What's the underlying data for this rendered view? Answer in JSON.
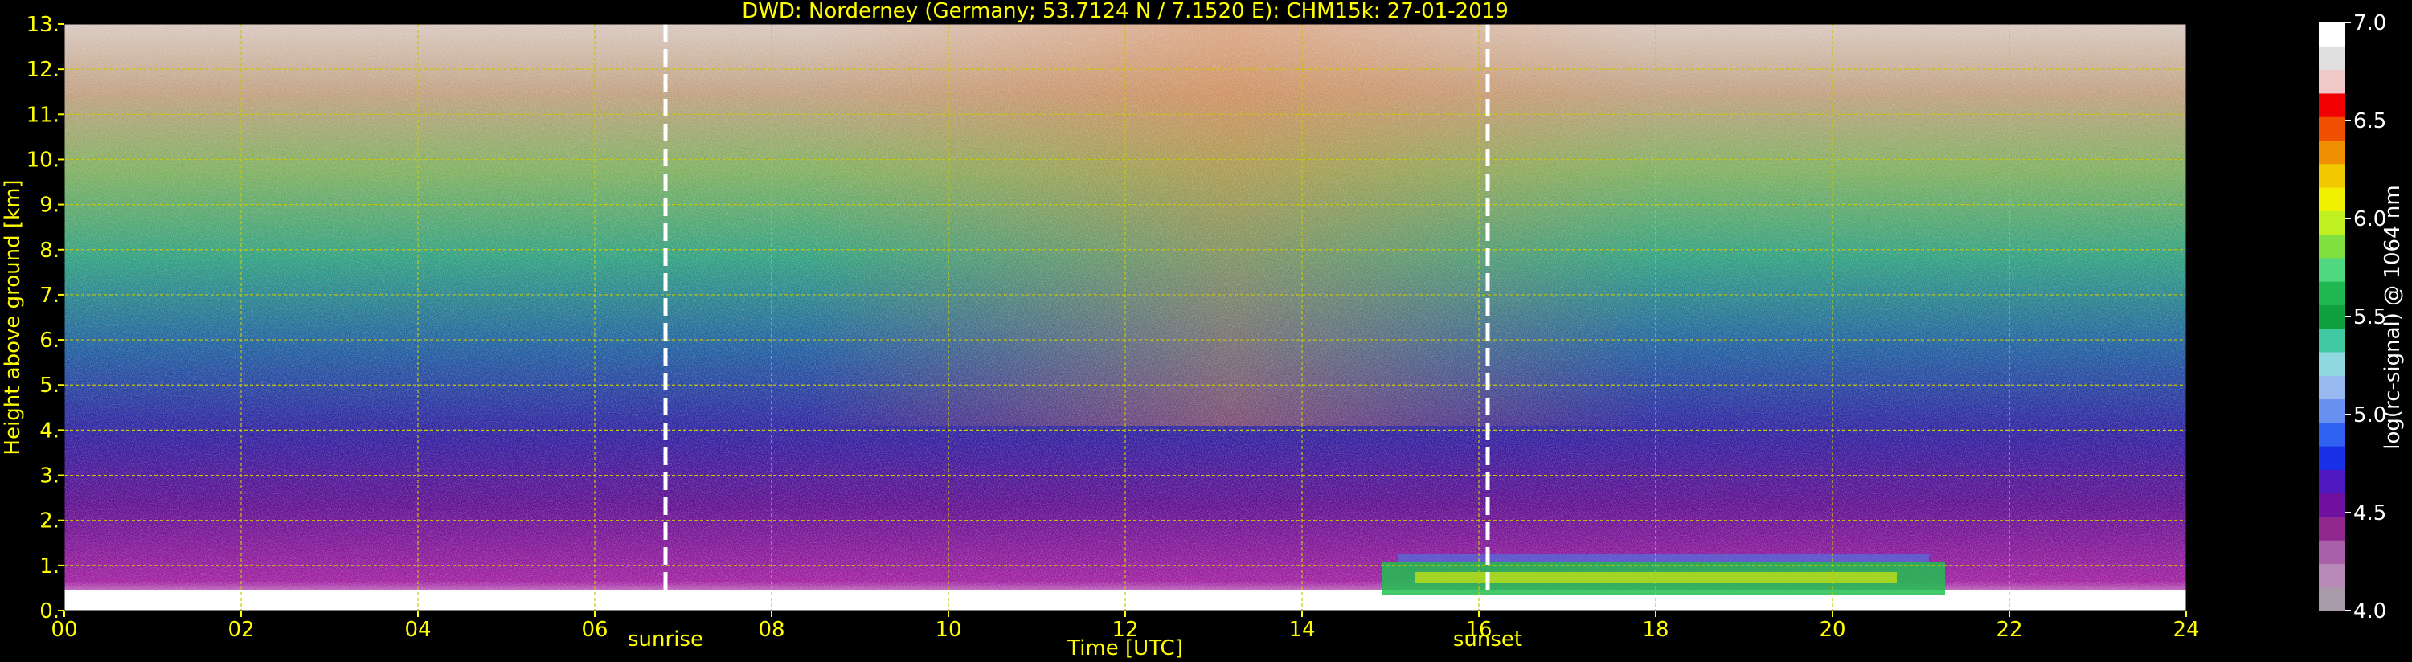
{
  "chart_data": {
    "type": "heatmap",
    "title": "DWD: Norderney (Germany; 53.7124 N / 7.1520 E):    CHM15k: 27-01-2019",
    "xlabel": "Time [UTC]",
    "ylabel": "Height above ground [km]",
    "xlim": [
      0,
      24
    ],
    "ylim": [
      0,
      13
    ],
    "x_ticks": [
      0,
      2,
      4,
      6,
      8,
      10,
      12,
      14,
      16,
      18,
      20,
      22,
      24
    ],
    "x_tick_labels": [
      "00",
      "02",
      "04",
      "06",
      "08",
      "10",
      "12",
      "14",
      "16",
      "18",
      "20",
      "22",
      "24"
    ],
    "y_ticks": [
      0,
      1,
      2,
      3,
      4,
      5,
      6,
      7,
      8,
      9,
      10,
      11,
      12,
      13
    ],
    "y_tick_labels": [
      "0.",
      "1.",
      "2.",
      "3.",
      "4.",
      "5.",
      "6.",
      "7.",
      "8.",
      "9.",
      "10.",
      "11.",
      "12.",
      "13."
    ],
    "grid": true,
    "annotations": [
      {
        "label": "sunrise",
        "x": 6.8
      },
      {
        "label": "sunset",
        "x": 16.1
      }
    ],
    "colorbar": {
      "label": "log(rc-signal) @ 1064 nm",
      "range": [
        4.0,
        7.0
      ],
      "ticks": [
        4.0,
        4.5,
        5.0,
        5.5,
        6.0,
        6.5,
        7.0
      ],
      "tick_labels": [
        "4.0",
        "4.5",
        "5.0",
        "5.5",
        "6.0",
        "6.5",
        "7.0"
      ],
      "colors": [
        "#a89aa8",
        "#b88ab8",
        "#a860a8",
        "#902890",
        "#7010a0",
        "#5018c0",
        "#1830e8",
        "#3060f0",
        "#6890f0",
        "#98b8f0",
        "#90d8e0",
        "#40c8a0",
        "#10a040",
        "#20b850",
        "#50d880",
        "#80e040",
        "#c0f020",
        "#f0f000",
        "#f0c800",
        "#f09000",
        "#f05000",
        "#f00000",
        "#f0c8c8",
        "#e0e0e0",
        "#ffffff"
      ]
    },
    "colors": {
      "text": "#ffff00",
      "grid": "#c8c800",
      "annotation_line": "#ffffff"
    }
  }
}
